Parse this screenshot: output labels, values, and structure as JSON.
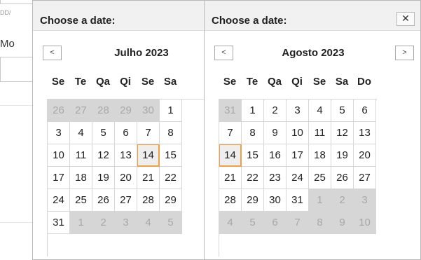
{
  "background": {
    "date_hint": "DD/",
    "label_fragment": "Mo"
  },
  "calendars": [
    {
      "title": "Choose a date:",
      "month": "Julho 2023",
      "nav": {
        "prev_icon": "chevron-left-icon",
        "prev_glyph": "<"
      },
      "weekdays": [
        "Se",
        "Te",
        "Qa",
        "Qi",
        "Se",
        "Sa"
      ],
      "weeks": [
        [
          {
            "d": "26",
            "o": true
          },
          {
            "d": "27",
            "o": true
          },
          {
            "d": "28",
            "o": true
          },
          {
            "d": "29",
            "o": true
          },
          {
            "d": "30",
            "o": true
          },
          {
            "d": "1",
            "o": false
          }
        ],
        [
          {
            "d": "3",
            "o": false
          },
          {
            "d": "4",
            "o": false
          },
          {
            "d": "5",
            "o": false
          },
          {
            "d": "6",
            "o": false
          },
          {
            "d": "7",
            "o": false
          },
          {
            "d": "8",
            "o": false
          }
        ],
        [
          {
            "d": "10",
            "o": false
          },
          {
            "d": "11",
            "o": false
          },
          {
            "d": "12",
            "o": false
          },
          {
            "d": "13",
            "o": false
          },
          {
            "d": "14",
            "o": false,
            "today": true
          },
          {
            "d": "15",
            "o": false
          }
        ],
        [
          {
            "d": "17",
            "o": false
          },
          {
            "d": "18",
            "o": false
          },
          {
            "d": "19",
            "o": false
          },
          {
            "d": "20",
            "o": false
          },
          {
            "d": "21",
            "o": false
          },
          {
            "d": "22",
            "o": false
          }
        ],
        [
          {
            "d": "24",
            "o": false
          },
          {
            "d": "25",
            "o": false
          },
          {
            "d": "26",
            "o": false
          },
          {
            "d": "27",
            "o": false
          },
          {
            "d": "28",
            "o": false
          },
          {
            "d": "29",
            "o": false
          }
        ],
        [
          {
            "d": "31",
            "o": false
          },
          {
            "d": "1",
            "o": true
          },
          {
            "d": "2",
            "o": true
          },
          {
            "d": "3",
            "o": true
          },
          {
            "d": "4",
            "o": true
          },
          {
            "d": "5",
            "o": true
          }
        ]
      ]
    },
    {
      "title": "Choose a date:",
      "close_glyph": "✕",
      "month": "Agosto 2023",
      "nav": {
        "prev_glyph": "<",
        "next_glyph": ">"
      },
      "weekdays": [
        "Se",
        "Te",
        "Qa",
        "Qi",
        "Se",
        "Sa",
        "Do"
      ],
      "weeks": [
        [
          {
            "d": "31",
            "o": true
          },
          {
            "d": "1",
            "o": false
          },
          {
            "d": "2",
            "o": false
          },
          {
            "d": "3",
            "o": false
          },
          {
            "d": "4",
            "o": false
          },
          {
            "d": "5",
            "o": false
          },
          {
            "d": "6",
            "o": false
          }
        ],
        [
          {
            "d": "7",
            "o": false
          },
          {
            "d": "8",
            "o": false
          },
          {
            "d": "9",
            "o": false
          },
          {
            "d": "10",
            "o": false
          },
          {
            "d": "11",
            "o": false
          },
          {
            "d": "12",
            "o": false
          },
          {
            "d": "13",
            "o": false
          }
        ],
        [
          {
            "d": "14",
            "o": false,
            "today": true
          },
          {
            "d": "15",
            "o": false
          },
          {
            "d": "16",
            "o": false
          },
          {
            "d": "17",
            "o": false
          },
          {
            "d": "18",
            "o": false
          },
          {
            "d": "19",
            "o": false
          },
          {
            "d": "20",
            "o": false
          }
        ],
        [
          {
            "d": "21",
            "o": false
          },
          {
            "d": "22",
            "o": false
          },
          {
            "d": "23",
            "o": false
          },
          {
            "d": "24",
            "o": false
          },
          {
            "d": "25",
            "o": false
          },
          {
            "d": "26",
            "o": false
          },
          {
            "d": "27",
            "o": false
          }
        ],
        [
          {
            "d": "28",
            "o": false
          },
          {
            "d": "29",
            "o": false
          },
          {
            "d": "30",
            "o": false
          },
          {
            "d": "31",
            "o": false
          },
          {
            "d": "1",
            "o": true
          },
          {
            "d": "2",
            "o": true
          },
          {
            "d": "3",
            "o": true
          }
        ],
        [
          {
            "d": "4",
            "o": true
          },
          {
            "d": "5",
            "o": true
          },
          {
            "d": "6",
            "o": true
          },
          {
            "d": "7",
            "o": true
          },
          {
            "d": "8",
            "o": true
          },
          {
            "d": "9",
            "o": true
          },
          {
            "d": "10",
            "o": true
          }
        ]
      ]
    }
  ],
  "colors": {
    "other_month_bg": "#d6d6d6",
    "today_border": "#f0a040",
    "header_bg": "#f1f1f1"
  }
}
